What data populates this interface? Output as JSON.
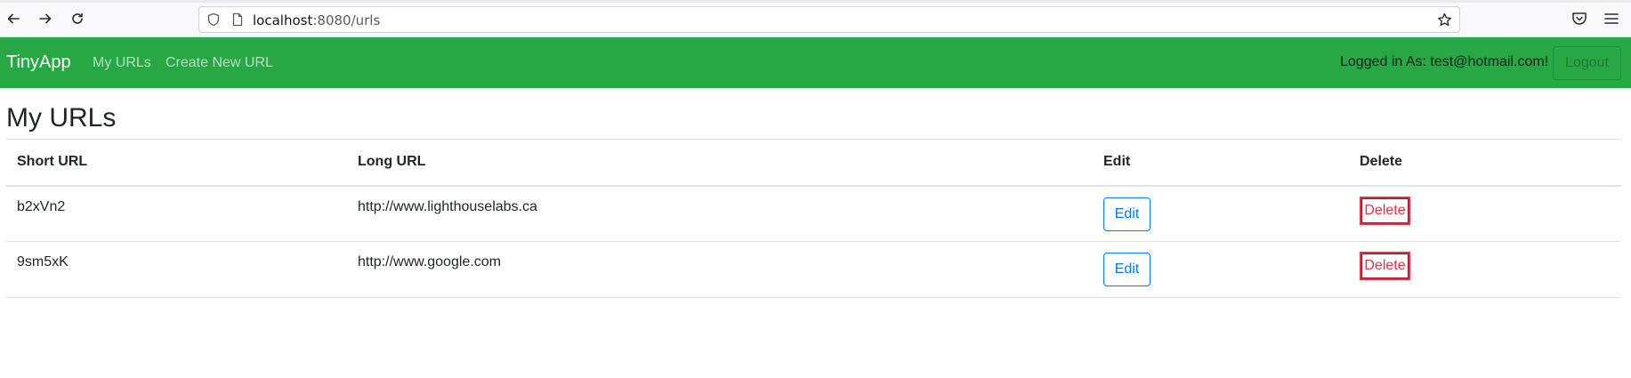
{
  "browser": {
    "url_host": "localhost",
    "url_rest": ":8080/urls",
    "icons": [
      "back-arrow-icon",
      "forward-arrow-icon",
      "reload-icon",
      "shield-icon",
      "page-icon",
      "star-icon",
      "pocket-icon",
      "hamburger-menu-icon"
    ]
  },
  "navbar": {
    "brand": "TinyApp",
    "links": [
      "My URLs",
      "Create New URL"
    ],
    "logged_in": "Logged in As: test@hotmail.com!",
    "logout_label": "Logout",
    "bg_color": "#28a745"
  },
  "main": {
    "title": "My URLs",
    "columns": [
      "Short URL",
      "Long URL",
      "Edit",
      "Delete"
    ],
    "rows": [
      {
        "short": "b2xVn2",
        "long": "http://www.lighthouselabs.ca",
        "edit": "Edit",
        "delete": "Delete"
      },
      {
        "short": "9sm5xK",
        "long": "http://www.google.com",
        "edit": "Edit",
        "delete": "Delete"
      }
    ]
  }
}
